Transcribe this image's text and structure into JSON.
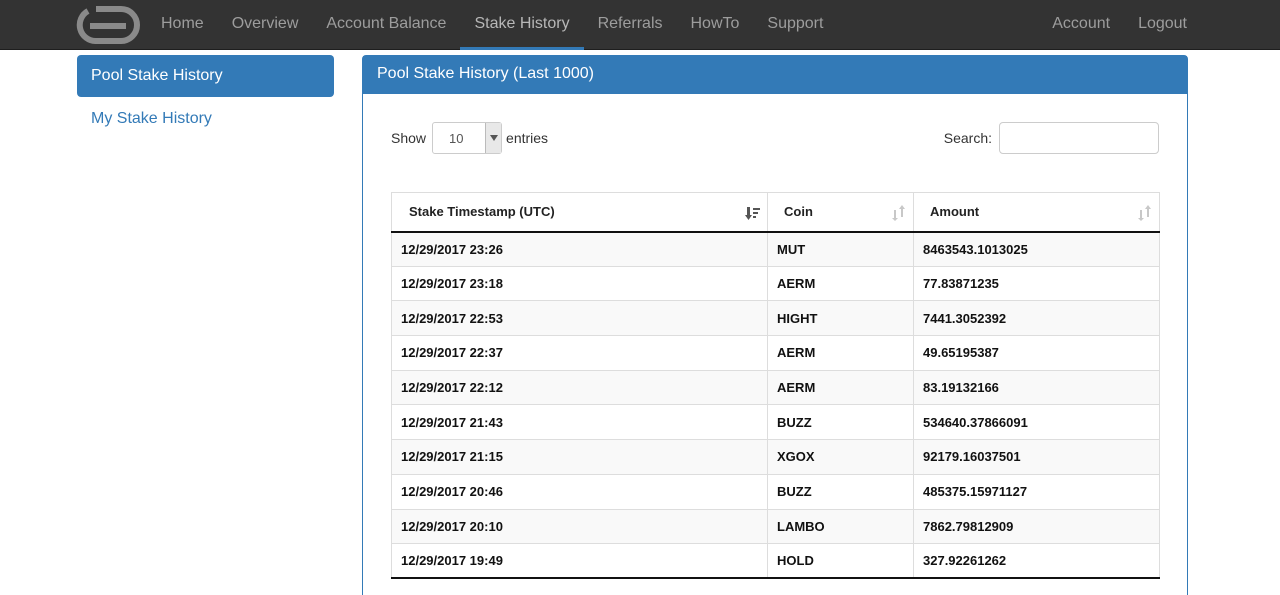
{
  "nav": {
    "left": [
      {
        "label": "Home",
        "active": false
      },
      {
        "label": "Overview",
        "active": false
      },
      {
        "label": "Account Balance",
        "active": false
      },
      {
        "label": "Stake History",
        "active": true
      },
      {
        "label": "Referrals",
        "active": false
      },
      {
        "label": "HowTo",
        "active": false
      },
      {
        "label": "Support",
        "active": false
      }
    ],
    "right": [
      {
        "label": "Account"
      },
      {
        "label": "Logout"
      }
    ]
  },
  "sidebar": {
    "items": [
      {
        "label": "Pool Stake History",
        "active": true
      },
      {
        "label": "My Stake History",
        "active": false
      }
    ]
  },
  "panel": {
    "title": "Pool Stake History (Last 1000)",
    "show_label": "Show",
    "page_length": "10",
    "entries_label": "entries",
    "search_label": "Search:",
    "search_value": ""
  },
  "table": {
    "columns": [
      {
        "label": "Stake Timestamp (UTC)",
        "sort": "desc"
      },
      {
        "label": "Coin",
        "sort": "none"
      },
      {
        "label": "Amount",
        "sort": "none"
      }
    ],
    "rows": [
      [
        "12/29/2017 23:26",
        "MUT",
        "8463543.1013025"
      ],
      [
        "12/29/2017 23:18",
        "AERM",
        "77.83871235"
      ],
      [
        "12/29/2017 22:53",
        "HIGHT",
        "7441.3052392"
      ],
      [
        "12/29/2017 22:37",
        "AERM",
        "49.65195387"
      ],
      [
        "12/29/2017 22:12",
        "AERM",
        "83.19132166"
      ],
      [
        "12/29/2017 21:43",
        "BUZZ",
        "534640.37866091"
      ],
      [
        "12/29/2017 21:15",
        "XGOX",
        "92179.16037501"
      ],
      [
        "12/29/2017 20:46",
        "BUZZ",
        "485375.15971127"
      ],
      [
        "12/29/2017 20:10",
        "LAMBO",
        "7862.79812909"
      ],
      [
        "12/29/2017 19:49",
        "HOLD",
        "327.92261262"
      ]
    ]
  },
  "colors": {
    "navbar": "#333333",
    "accent": "#337ab7",
    "nav_text": "#9d9d9d"
  }
}
